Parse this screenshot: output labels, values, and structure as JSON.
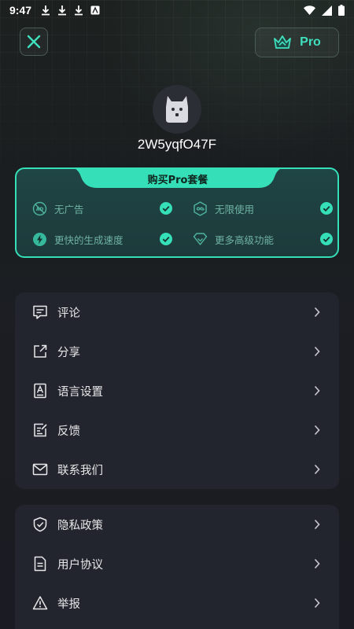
{
  "status_bar": {
    "time": "9:47",
    "icons_left": [
      "download-icon",
      "download-icon",
      "download-icon",
      "app-icon"
    ],
    "icons_right": [
      "wifi-icon",
      "signal-icon",
      "battery-icon"
    ]
  },
  "header": {
    "close_icon": "close-icon",
    "pro_button_label": "Pro",
    "pro_icon": "crown-icon"
  },
  "profile": {
    "avatar_icon": "dog-avatar-icon",
    "user_id": "2W5yqfO47F"
  },
  "pro_card": {
    "title": "购买Pro套餐",
    "accent": "#35dfb8",
    "features": [
      {
        "icon": "no-ads-icon",
        "label": "无广告"
      },
      {
        "icon": "infinity-icon",
        "label": "无限使用"
      },
      {
        "icon": "lightning-icon",
        "label": "更快的生成速度"
      },
      {
        "icon": "diamond-icon",
        "label": "更多高级功能"
      }
    ]
  },
  "menu_group_1": [
    {
      "icon": "comment-icon",
      "label": "评论"
    },
    {
      "icon": "share-icon",
      "label": "分享"
    },
    {
      "icon": "language-icon",
      "label": "语言设置"
    },
    {
      "icon": "feedback-icon",
      "label": "反馈"
    },
    {
      "icon": "mail-icon",
      "label": "联系我们"
    }
  ],
  "menu_group_2": [
    {
      "icon": "shield-icon",
      "label": "隐私政策"
    },
    {
      "icon": "document-icon",
      "label": "用户协议"
    },
    {
      "icon": "warning-icon",
      "label": "举报"
    }
  ]
}
